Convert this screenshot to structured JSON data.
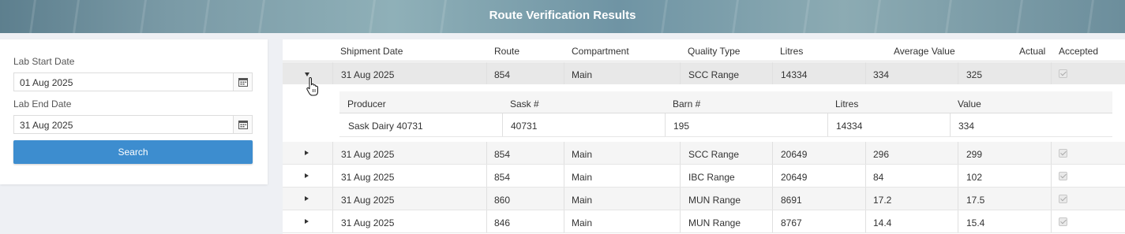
{
  "header": {
    "title": "Route Verification Results"
  },
  "filters": {
    "start_label": "Lab Start Date",
    "start_value": "01 Aug 2025",
    "end_label": "Lab End Date",
    "end_value": "31 Aug 2025",
    "search_label": "Search"
  },
  "grid": {
    "columns": [
      "Shipment Date",
      "Route",
      "Compartment",
      "Quality Type",
      "Litres",
      "Average Value",
      "Actual",
      "Accepted"
    ],
    "rows": [
      {
        "date": "31 Aug 2025",
        "route": "854",
        "compartment": "Main",
        "quality": "SCC Range",
        "litres": "14334",
        "average": "334",
        "actual": "325",
        "accepted": true,
        "expanded": true
      },
      {
        "date": "31 Aug 2025",
        "route": "854",
        "compartment": "Main",
        "quality": "SCC Range",
        "litres": "20649",
        "average": "296",
        "actual": "299",
        "accepted": true,
        "expanded": false
      },
      {
        "date": "31 Aug 2025",
        "route": "854",
        "compartment": "Main",
        "quality": "IBC Range",
        "litres": "20649",
        "average": "84",
        "actual": "102",
        "accepted": true,
        "expanded": false
      },
      {
        "date": "31 Aug 2025",
        "route": "860",
        "compartment": "Main",
        "quality": "MUN Range",
        "litres": "8691",
        "average": "17.2",
        "actual": "17.5",
        "accepted": true,
        "expanded": false
      },
      {
        "date": "31 Aug 2025",
        "route": "846",
        "compartment": "Main",
        "quality": "MUN Range",
        "litres": "8767",
        "average": "14.4",
        "actual": "15.4",
        "accepted": true,
        "expanded": false
      }
    ]
  },
  "detail": {
    "columns": [
      "Producer",
      "Sask #",
      "Barn #",
      "Litres",
      "Value"
    ],
    "row": {
      "producer": "Sask Dairy 40731",
      "sask": "40731",
      "barn": "195",
      "litres": "14334",
      "value": "334"
    }
  },
  "icons": {
    "calendar": "calendar-icon",
    "expand": "triangle-right-icon",
    "collapse": "triangle-down-icon",
    "cursor": "pointer-hand-icon"
  },
  "colors": {
    "primary_button": "#3d8dcf",
    "banner_text": "#ffffff"
  }
}
